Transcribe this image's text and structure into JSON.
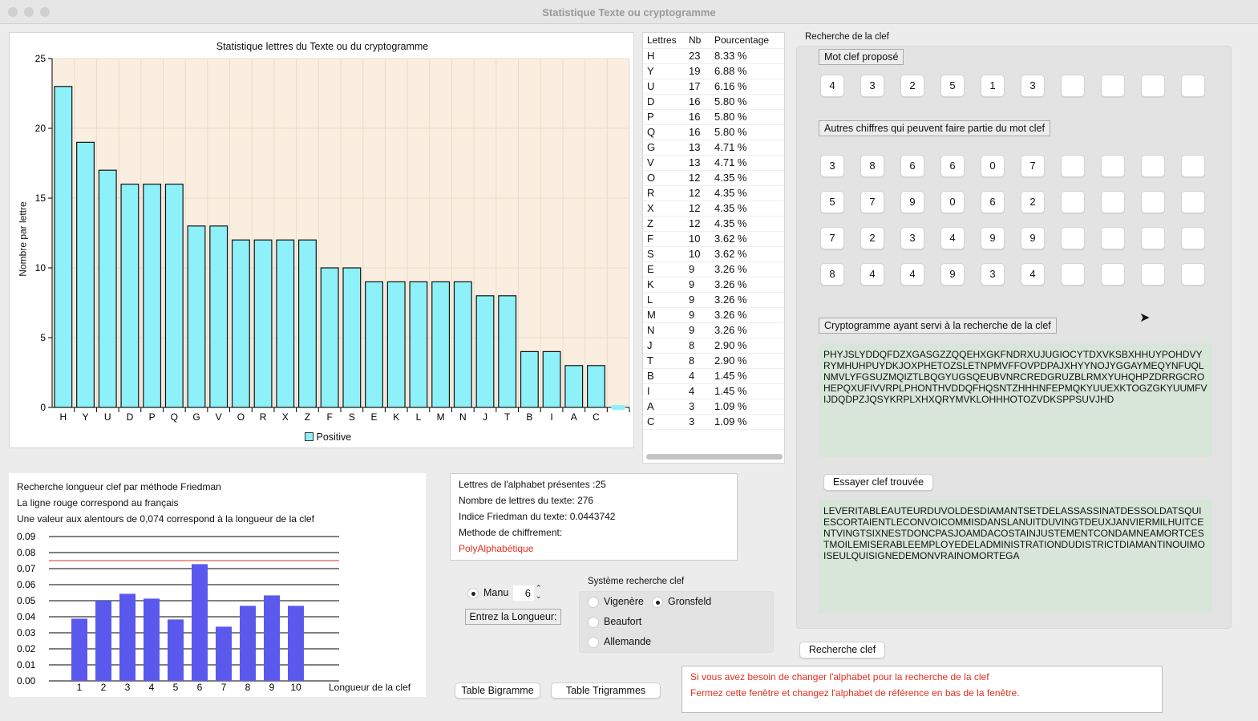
{
  "window": {
    "title": "Statistique Texte ou cryptogramme"
  },
  "letter_chart": {
    "chart_data": {
      "type": "bar",
      "title": "Statistique lettres du Texte ou du cryptogramme",
      "ylabel": "Nombre par lettre",
      "xlabel": "",
      "ylim": [
        0,
        25
      ],
      "yticks": [
        0,
        5,
        10,
        15,
        20,
        25
      ],
      "grid": true,
      "legend_placement": "bottom",
      "categories": [
        "H",
        "Y",
        "U",
        "D",
        "P",
        "Q",
        "G",
        "V",
        "O",
        "R",
        "X",
        "Z",
        "F",
        "S",
        "E",
        "K",
        "L",
        "M",
        "N",
        "J",
        "T",
        "B",
        "I",
        "A",
        "C",
        ""
      ],
      "series": [
        {
          "name": "Positive",
          "values": [
            23,
            19,
            17,
            16,
            16,
            16,
            13,
            13,
            12,
            12,
            12,
            12,
            10,
            10,
            9,
            9,
            9,
            9,
            9,
            8,
            8,
            4,
            4,
            3,
            3,
            0
          ]
        }
      ],
      "colors": {
        "bar": "#8ef0f8",
        "plot_bg": "#faeee0"
      }
    }
  },
  "freq_table": {
    "headers": [
      "Lettres",
      "Nb",
      "Pourcentage"
    ],
    "rows": [
      [
        "H",
        "23",
        "8.33 %"
      ],
      [
        "Y",
        "19",
        "6.88 %"
      ],
      [
        "U",
        "17",
        "6.16 %"
      ],
      [
        "D",
        "16",
        "5.80 %"
      ],
      [
        "P",
        "16",
        "5.80 %"
      ],
      [
        "Q",
        "16",
        "5.80 %"
      ],
      [
        "G",
        "13",
        "4.71 %"
      ],
      [
        "V",
        "13",
        "4.71 %"
      ],
      [
        "O",
        "12",
        "4.35 %"
      ],
      [
        "R",
        "12",
        "4.35 %"
      ],
      [
        "X",
        "12",
        "4.35 %"
      ],
      [
        "Z",
        "12",
        "4.35 %"
      ],
      [
        "F",
        "10",
        "3.62 %"
      ],
      [
        "S",
        "10",
        "3.62 %"
      ],
      [
        "E",
        "9",
        "3.26 %"
      ],
      [
        "K",
        "9",
        "3.26 %"
      ],
      [
        "L",
        "9",
        "3.26 %"
      ],
      [
        "M",
        "9",
        "3.26 %"
      ],
      [
        "N",
        "9",
        "3.26 %"
      ],
      [
        "J",
        "8",
        "2.90 %"
      ],
      [
        "T",
        "8",
        "2.90 %"
      ],
      [
        "B",
        "4",
        "1.45 %"
      ],
      [
        "I",
        "4",
        "1.45 %"
      ],
      [
        "A",
        "3",
        "1.09 %"
      ],
      [
        "C",
        "3",
        "1.09 %"
      ]
    ]
  },
  "key_search": {
    "heading": "Recherche de la clef",
    "proposed_label": "Mot clef proposé",
    "proposed": [
      "4",
      "3",
      "2",
      "5",
      "1",
      "3",
      "",
      "",
      "",
      ""
    ],
    "others_label": "Autres chiffres qui peuvent faire partie du mot clef",
    "others": [
      [
        "3",
        "8",
        "6",
        "6",
        "0",
        "7",
        "",
        "",
        "",
        ""
      ],
      [
        "5",
        "7",
        "9",
        "0",
        "6",
        "2",
        "",
        "",
        "",
        ""
      ],
      [
        "7",
        "2",
        "3",
        "4",
        "9",
        "9",
        "",
        "",
        "",
        ""
      ],
      [
        "8",
        "4",
        "4",
        "9",
        "3",
        "4",
        "",
        "",
        "",
        ""
      ]
    ],
    "crypto_label": "Cryptogramme ayant servi à la recherche de la clef",
    "cryptogram": "PHYJSLYDDQFDZXGASGZZQQEHXGKFNDRXUJUGIOCYTDXVKSBXHHUYPOHDVYRYMHUHPUYDKJOXPHETOZSLETNPMVFFOVPDPAJXHYYNOJYGGAYMEQYNFUQLNMVLYFGSUZMQIZTLBQGYUGSQEUBVNRCREDGRUZBLRMXYUHQHPZDRRGCROHEPQXUFIVVRPLPHONTHVDDQFHQSNTZHHHNFEPMQKYUUEXKTOGZGKYUUMFVIJDQDPZJQSYKRPLXHXQRYMVKLOHHHOTOZVDKSPPSUVJHD",
    "try_button": "Essayer clef trouvée",
    "plaintext": "LEVERITABLEAUTEURDUVOLDESDIAMANTSETDELASSASSINATDESSOLDATSQUIESCORTAIENTLECONVOICOMMISDANSLANUITDUVINGTDEUXJANVIERMILHUITCENTVINGTSIXNESTDONCPASJOAMDACOSTAINJUSTEMENTCONDAMNEAMORTCESTMOILEMISERABLEEMPLOYEDELADMINISTRATIONDUDISTRICTDIAMANTINOUIMOISEULQUISIGNEDEMONVRAINOMORTEGA",
    "search_button": "Recherche clef"
  },
  "friedman": {
    "line1": "Recherche longueur clef par méthode Friedman",
    "line2": "La ligne rouge correspond au français",
    "line3": "Une valeur aux alentours de 0,074 correspond à la longueur de la clef",
    "chart_data": {
      "type": "bar",
      "xlabel": "Longueur de la clef",
      "ylabel": "",
      "ylim": [
        0,
        0.09
      ],
      "yticks": [
        "0.00",
        "0.01",
        "0.02",
        "0.03",
        "0.04",
        "0.05",
        "0.06",
        "0.07",
        "0.08",
        "0.09"
      ],
      "categories": [
        "1",
        "2",
        "3",
        "4",
        "5",
        "6",
        "7",
        "8",
        "9",
        "10"
      ],
      "values": [
        0.0388,
        0.05,
        0.0543,
        0.0513,
        0.0383,
        0.0728,
        0.0338,
        0.0468,
        0.0533,
        0.0468
      ],
      "reference_line": 0.075,
      "grid": true,
      "colors": {
        "bar": "#5b58ee",
        "reference": "#e03020"
      }
    }
  },
  "stats": {
    "present": "Lettres de l'alphabet présentes :25",
    "count": "Nombre de lettres du texte: 276",
    "index": "Indice Friedman du texte: 0.0443742",
    "method_label": "Methode de chiffrement:",
    "method": "PolyAlphabétique",
    "method_color": "#e03020"
  },
  "length_input": {
    "manu_label": "Manu",
    "value": "6",
    "enter_button": "Entrez la Longueur:"
  },
  "system": {
    "label": "Système recherche clef",
    "options": [
      {
        "label": "Vigenère",
        "selected": false
      },
      {
        "label": "Gronsfeld",
        "selected": true
      },
      {
        "label": "Beaufort",
        "selected": false
      },
      {
        "label": "Allemande",
        "selected": false
      }
    ]
  },
  "buttons": {
    "bigram": "Table Bigramme",
    "trigram": "Table Trigrammes"
  },
  "notice": {
    "line1": "Si vous avez besoin de changer l'alphabet pour la recherche de la clef",
    "line2": "Fermez cette fenêtre et changez l'alphabet de référence en bas de la fenêtre."
  }
}
